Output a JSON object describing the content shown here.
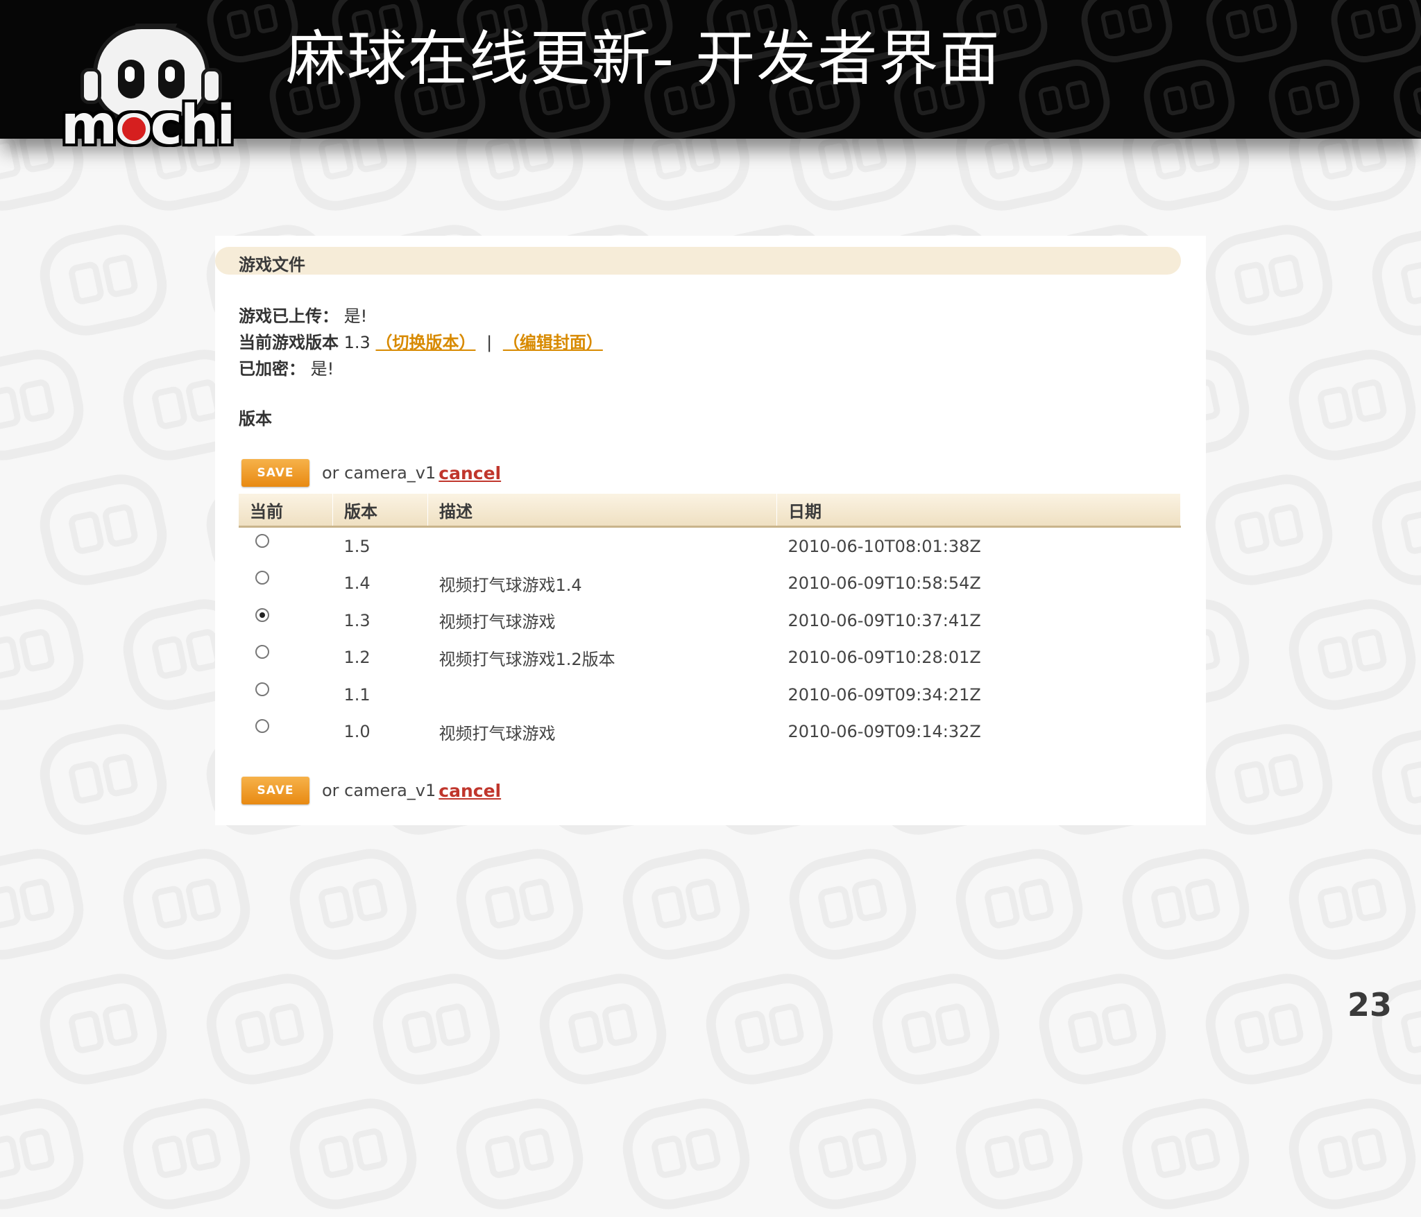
{
  "slide": {
    "title": "麻球在线更新- 开发者界面",
    "page_number": "23",
    "logo_text": "mochi"
  },
  "panel": {
    "section_title": "游戏文件",
    "uploaded": {
      "label": "游戏已上传：",
      "value": "是!"
    },
    "current_version": {
      "label": "当前游戏版本",
      "value": "1.3",
      "switch_link": "（切换版本）",
      "separator": "|",
      "edit_cover_link": "（编辑封面）"
    },
    "encrypted": {
      "label": "已加密：",
      "value": "是!"
    },
    "versions_label": "版本",
    "save_label": "SAVE",
    "or_text": "or camera_v1",
    "cancel_label": "cancel",
    "table": {
      "headers": [
        "当前",
        "版本",
        "描述",
        "日期"
      ],
      "rows": [
        {
          "selected": false,
          "version": "1.5",
          "description": "",
          "date": "2010-06-10T08:01:38Z"
        },
        {
          "selected": false,
          "version": "1.4",
          "description": "视频打气球游戏1.4",
          "date": "2010-06-09T10:58:54Z"
        },
        {
          "selected": true,
          "version": "1.3",
          "description": "视频打气球游戏",
          "date": "2010-06-09T10:37:41Z"
        },
        {
          "selected": false,
          "version": "1.2",
          "description": "视频打气球游戏1.2版本",
          "date": "2010-06-09T10:28:01Z"
        },
        {
          "selected": false,
          "version": "1.1",
          "description": "",
          "date": "2010-06-09T09:34:21Z"
        },
        {
          "selected": false,
          "version": "1.0",
          "description": "视频打气球游戏",
          "date": "2010-06-09T09:14:32Z"
        }
      ]
    }
  },
  "colors": {
    "banner": "#060606",
    "link_orange": "#d88a00",
    "cancel_red": "#c0362c",
    "save_button": "#ee9a22",
    "logo_red": "#d61f1f"
  },
  "icons": [
    "mochi-logo-icon",
    "radio-button-icon"
  ]
}
